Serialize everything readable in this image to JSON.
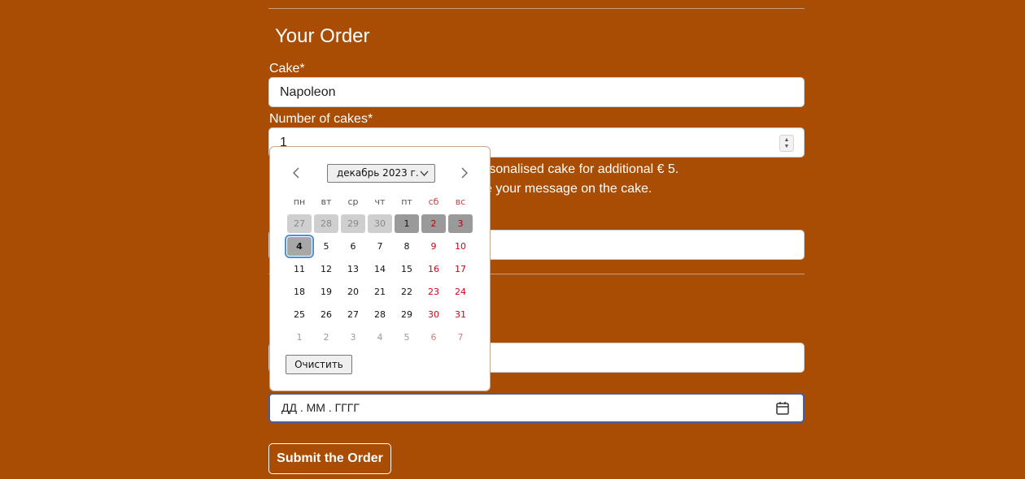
{
  "section_title": "Your Order",
  "fields": {
    "cake_label": "Cake*",
    "cake_value": "Napoleon",
    "number_label": "Number of cakes*",
    "number_value": "1",
    "date_placeholder": "ДД . ММ . ГГГГ"
  },
  "info": {
    "line1": "rsonalised cake for additional € 5.",
    "line2": "e your message on the cake."
  },
  "submit_label": "Submit the Order",
  "calendar": {
    "month_year": "декабрь 2023 г.",
    "weekdays": [
      "пн",
      "вт",
      "ср",
      "чт",
      "пт",
      "сб",
      "вс"
    ],
    "weeks": [
      [
        "27",
        "28",
        "29",
        "30",
        "1",
        "2",
        "3"
      ],
      [
        "4",
        "5",
        "6",
        "7",
        "8",
        "9",
        "10"
      ],
      [
        "11",
        "12",
        "13",
        "14",
        "15",
        "16",
        "17"
      ],
      [
        "18",
        "19",
        "20",
        "21",
        "22",
        "23",
        "24"
      ],
      [
        "25",
        "26",
        "27",
        "28",
        "29",
        "30",
        "31"
      ],
      [
        "1",
        "2",
        "3",
        "4",
        "5",
        "6",
        "7"
      ]
    ],
    "today": "4",
    "clear_label": "Очистить"
  },
  "colors": {
    "page_background": "#a84d03",
    "weekend_text": "#d0021b",
    "focus_ring": "#4a90e2"
  }
}
